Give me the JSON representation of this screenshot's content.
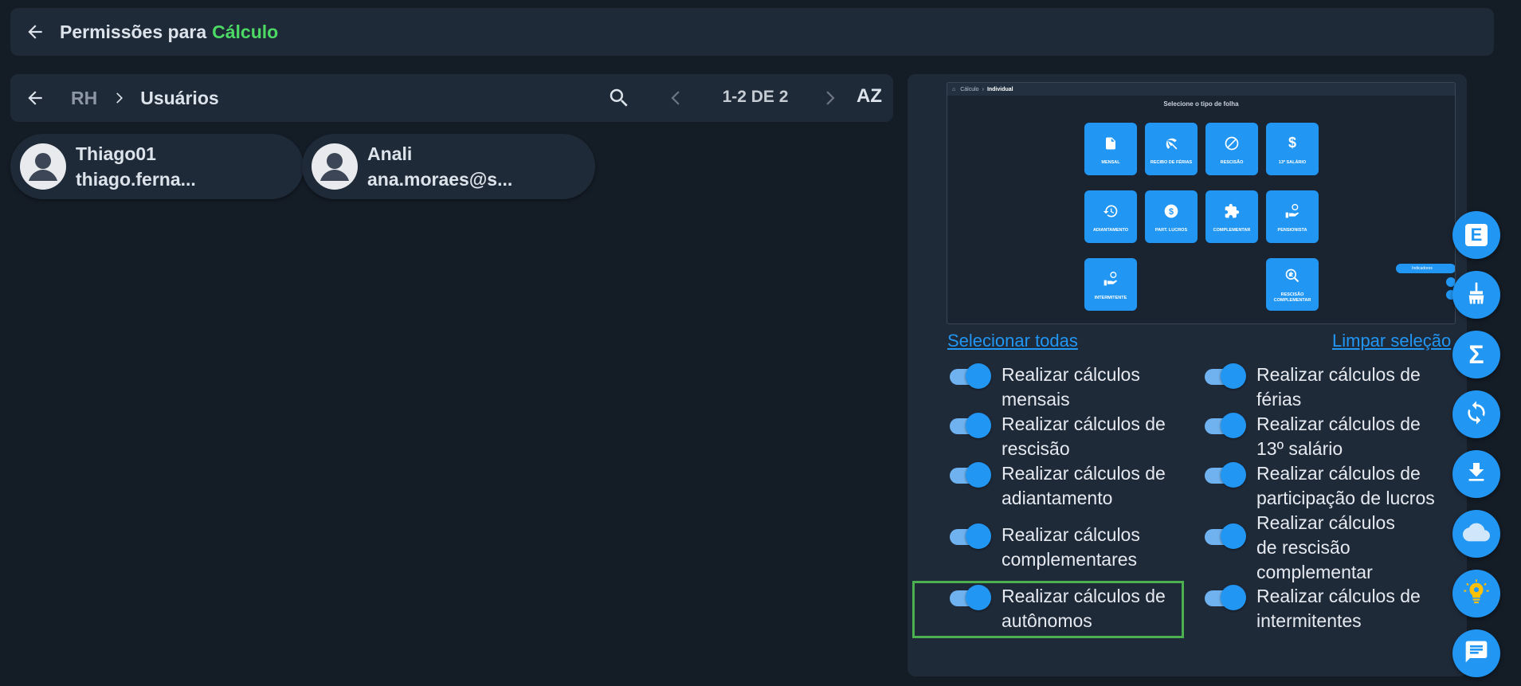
{
  "header": {
    "title_prefix": "Permissões para",
    "title_accent": "Cálculo"
  },
  "breadcrumb": {
    "parent": "RH",
    "current": "Usuários",
    "pager": "1-2 DE 2",
    "sort": "AZ"
  },
  "users": [
    {
      "name": "Thiago01",
      "email": "thiago.ferna..."
    },
    {
      "name": "Anali",
      "email": "ana.moraes@s..."
    }
  ],
  "preview": {
    "breadcrumb_parent": "Cálculo",
    "breadcrumb_current": "Individual",
    "title": "Selecione o tipo de folha",
    "tiles": [
      {
        "label": "MENSAL"
      },
      {
        "label": "RECIBO DE FÉRIAS"
      },
      {
        "label": "RESCISÃO"
      },
      {
        "label": "13º SALÁRIO"
      },
      {
        "label": "ADIANTAMENTO"
      },
      {
        "label": "PART. LUCROS"
      },
      {
        "label": "COMPLEMENTAR"
      },
      {
        "label": "PENSIONISTA"
      },
      {
        "label": "INTERMITENTE"
      },
      {
        "label": "RESCISÃO COMPLEMENTAR"
      }
    ],
    "pill_label": "Indicadores"
  },
  "links": {
    "select_all": "Selecionar todas",
    "clear": "Limpar seleção"
  },
  "permissions": [
    {
      "label": "Realizar cálculos mensais",
      "enabled": true
    },
    {
      "label": "Realizar cálculos de férias",
      "enabled": true
    },
    {
      "label": "Realizar cálculos de rescisão",
      "enabled": true
    },
    {
      "label": "Realizar cálculos de 13º salário",
      "enabled": true
    },
    {
      "label": "Realizar cálculos de adiantamento",
      "enabled": true
    },
    {
      "label": "Realizar cálculos de participação de lucros",
      "enabled": true
    },
    {
      "label": "Realizar cálculos complementares",
      "enabled": true
    },
    {
      "label": "Realizar cálculos de rescisão complementar",
      "enabled": true
    },
    {
      "label": "Realizar cálculos de autônomos",
      "enabled": true
    },
    {
      "label": "Realizar cálculos de intermitentes",
      "enabled": true
    }
  ],
  "fabs": [
    {
      "icon": "e-letter-icon",
      "label": "E"
    },
    {
      "icon": "broom-icon"
    },
    {
      "icon": "sigma-icon",
      "label": "Σ"
    },
    {
      "icon": "sync-icon"
    },
    {
      "icon": "download-icon"
    },
    {
      "icon": "cloud-icon"
    },
    {
      "icon": "lightbulb-icon"
    },
    {
      "icon": "chat-icon"
    }
  ],
  "colors": {
    "accent": "#4cd964",
    "primary": "#2196f3",
    "panel": "#1f2a39",
    "background": "#141c26",
    "highlight": "#4caf50"
  }
}
